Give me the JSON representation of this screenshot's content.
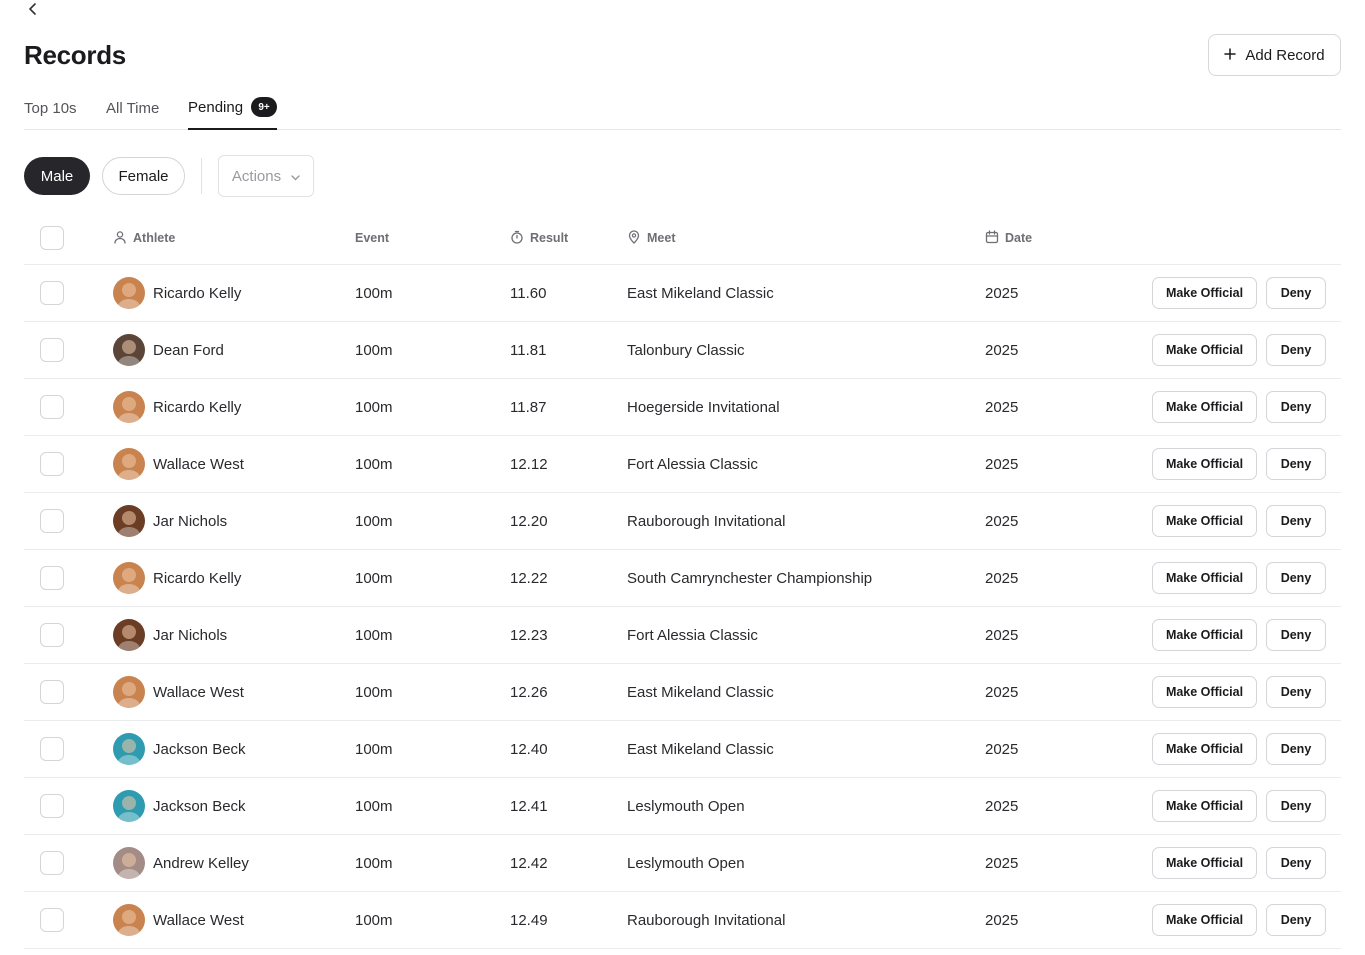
{
  "page": {
    "title": "Records",
    "add_button": "Add Record"
  },
  "tabs": [
    {
      "label": "Top 10s"
    },
    {
      "label": "All Time"
    },
    {
      "label": "Pending",
      "badge": "9+"
    }
  ],
  "filters": {
    "male": "Male",
    "female": "Female",
    "actions": "Actions"
  },
  "table": {
    "headers": {
      "athlete": "Athlete",
      "event": "Event",
      "result": "Result",
      "meet": "Meet",
      "date": "Date"
    },
    "action_labels": {
      "official": "Make Official",
      "deny": "Deny"
    },
    "rows": [
      {
        "athlete": "Ricardo Kelly",
        "event": "100m",
        "result": "11.60",
        "meet": "East Mikeland Classic",
        "date": "2025",
        "avatar": "#c9834f"
      },
      {
        "athlete": "Dean Ford",
        "event": "100m",
        "result": "11.81",
        "meet": "Talonbury Classic",
        "date": "2025",
        "avatar": "#5a4538"
      },
      {
        "athlete": "Ricardo Kelly",
        "event": "100m",
        "result": "11.87",
        "meet": "Hoegerside Invitational",
        "date": "2025",
        "avatar": "#c9834f"
      },
      {
        "athlete": "Wallace West",
        "event": "100m",
        "result": "12.12",
        "meet": "Fort Alessia Classic",
        "date": "2025",
        "avatar": "#c9834f"
      },
      {
        "athlete": "Jar Nichols",
        "event": "100m",
        "result": "12.20",
        "meet": "Rauborough Invitational",
        "date": "2025",
        "avatar": "#6b3d25"
      },
      {
        "athlete": "Ricardo Kelly",
        "event": "100m",
        "result": "12.22",
        "meet": "South Camrynchester Championship",
        "date": "2025",
        "avatar": "#c9834f"
      },
      {
        "athlete": "Jar Nichols",
        "event": "100m",
        "result": "12.23",
        "meet": "Fort Alessia Classic",
        "date": "2025",
        "avatar": "#6b3d25"
      },
      {
        "athlete": "Wallace West",
        "event": "100m",
        "result": "12.26",
        "meet": "East Mikeland Classic",
        "date": "2025",
        "avatar": "#c9834f"
      },
      {
        "athlete": "Jackson Beck",
        "event": "100m",
        "result": "12.40",
        "meet": "East Mikeland Classic",
        "date": "2025",
        "avatar": "#2f9bb0"
      },
      {
        "athlete": "Jackson Beck",
        "event": "100m",
        "result": "12.41",
        "meet": "Leslymouth Open",
        "date": "2025",
        "avatar": "#2f9bb0"
      },
      {
        "athlete": "Andrew Kelley",
        "event": "100m",
        "result": "12.42",
        "meet": "Leslymouth Open",
        "date": "2025",
        "avatar": "#a48c86"
      },
      {
        "athlete": "Wallace West",
        "event": "100m",
        "result": "12.49",
        "meet": "Rauborough Invitational",
        "date": "2025",
        "avatar": "#c9834f"
      }
    ]
  }
}
